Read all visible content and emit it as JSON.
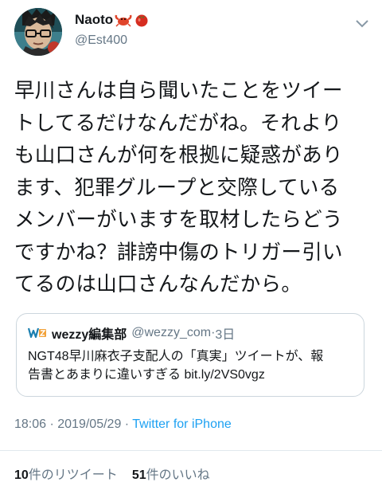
{
  "tweet": {
    "display_name": "Naoto",
    "name_emojis": [
      "crab-icon",
      "tomato-icon"
    ],
    "handle": "@Est400",
    "text_lines": [
      "早川さんは自ら聞いたことをツイー",
      "トしてるだけなんだがね。それより",
      "も山口さんが何を根拠に疑惑があり",
      "ます、犯罪グループと交際している",
      "メンバーがいますを取材したらどう",
      "ですかね？誹謗中傷のトリガー引い",
      "てるのは山口さんなんだから。"
    ],
    "timestamp": "18:06 · 2019/05/29 · ",
    "source": "Twitter for iPhone"
  },
  "quoted": {
    "logo_text": "WEZZY",
    "name": "wezzy編集部",
    "handle": "@wezzy_com",
    "dot": "·",
    "time": "3日",
    "text_lines": [
      "NGT48早川麻衣子支配人の「真実」ツイートが、報",
      "告書とあまりに違いすぎる bit.ly/2VS0vgz"
    ]
  },
  "stats": {
    "retweets_count": "10",
    "retweets_label": "件のリツイート",
    "likes_count": "51",
    "likes_label": "件のいいね"
  },
  "colors": {
    "text": "#14171a",
    "secondary": "#657786",
    "link": "#1da1f2",
    "border": "#ccd6dd"
  }
}
